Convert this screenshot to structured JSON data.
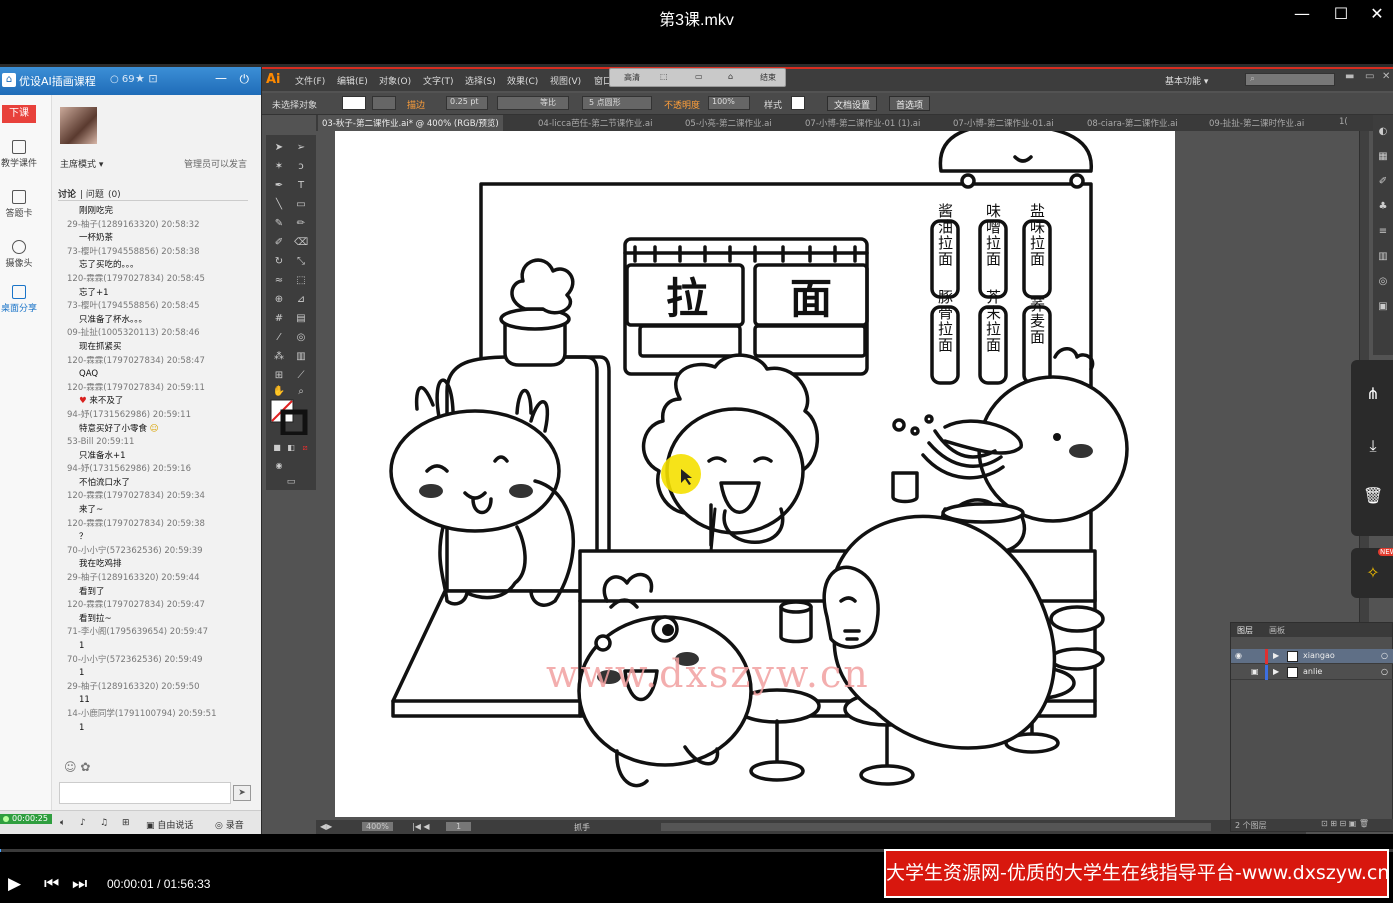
{
  "player": {
    "title": "第3课.mkv",
    "time_current": "00:00:01",
    "time_separator": "/",
    "time_total": "01:56:33",
    "progress_fraction": 0.0001,
    "win_minimize": "—",
    "win_maximize": "☐",
    "win_close": "✕"
  },
  "banner": {
    "text": "大学生资源网-优质的大学生在线指导平台-www.dxszyw.cn"
  },
  "classroom": {
    "title": "优设AI插画课程",
    "count": "69",
    "exit_label": "下课",
    "nav": [
      {
        "label": "教学课件",
        "icon": "courseware-icon"
      },
      {
        "label": "答题卡",
        "icon": "answer-card-icon"
      },
      {
        "label": "摄像头",
        "icon": "camera-icon"
      },
      {
        "label": "桌面分享",
        "icon": "screen-share-icon"
      }
    ],
    "mode": "主席模式",
    "mode_note": "管理员可以发言",
    "tab_discuss": "讨论",
    "tab_question": "问题",
    "tab_question_count": "(0)",
    "messages": [
      {
        "meta": "",
        "text": "刚刚吃完"
      },
      {
        "meta": "29-柚子(1289163320) 20:58:32",
        "text": "一杯奶茶"
      },
      {
        "meta": "73-樱叶(1794558856) 20:58:38",
        "text": "忘了买吃的。。。"
      },
      {
        "meta": "120-霖霖(1797027834) 20:58:45",
        "text": "忘了+1"
      },
      {
        "meta": "73-樱叶(1794558856) 20:58:45",
        "text": "只准备了杯水。。。"
      },
      {
        "meta": "09-扯扯(1005320113) 20:58:46",
        "text": "现在抓紧买"
      },
      {
        "meta": "120-霖霖(1797027834) 20:58:47",
        "text": "QAQ"
      },
      {
        "meta": "120-霖霖(1797027834) 20:59:11",
        "text": "来不及了"
      },
      {
        "meta": "94-妤(1731562986) 20:59:11",
        "text": "特意买好了小零食"
      },
      {
        "meta": "53-Bill 20:59:11",
        "text": "只准备水+1"
      },
      {
        "meta": "94-妤(1731562986) 20:59:16",
        "text": "不怕流口水了"
      },
      {
        "meta": "120-霖霖(1797027834) 20:59:34",
        "text": "来了~"
      },
      {
        "meta": "120-霖霖(1797027834) 20:59:38",
        "text": "？"
      },
      {
        "meta": "70-小小宁(572362536) 20:59:39",
        "text": "我在吃鸡排"
      },
      {
        "meta": "29-柚子(1289163320) 20:59:44",
        "text": "看到了"
      },
      {
        "meta": "120-霖霖(1797027834) 20:59:47",
        "text": "看到拉~"
      },
      {
        "meta": "71-李小阁(1795639654) 20:59:47",
        "text": "1"
      },
      {
        "meta": "70-小小宁(572362536) 20:59:49",
        "text": "1"
      },
      {
        "meta": "29-柚子(1289163320) 20:59:50",
        "text": "11"
      },
      {
        "meta": "14-小鹿同学(1791100794) 20:59:51",
        "text": "1"
      }
    ],
    "live_time": "00:00:25",
    "bottom_free": "自由说话",
    "bottom_record": "录音"
  },
  "illustrator": {
    "logo": "Ai",
    "menus": [
      "文件(F)",
      "编辑(E)",
      "对象(O)",
      "文字(T)",
      "选择(S)",
      "效果(C)",
      "视图(V)",
      "窗口"
    ],
    "quick_bar": {
      "a": "高清",
      "end": "结束"
    },
    "workspace": "基本功能",
    "control": {
      "no_selection": "未选择对象",
      "stroke_label": "描边",
      "stroke_value": "0.25 pt",
      "profile": "等比",
      "brush": "5 点圆形",
      "opacity_label": "不透明度",
      "opacity_value": "100%",
      "style_label": "样式",
      "doc_setup": "文档设置",
      "prefs": "首选项"
    },
    "doc_tabs": [
      "03-秋子-第二课作业.ai* @ 400% (RGB/预览)",
      "04-licca芭任-第二节课作业.ai",
      "05-小亮-第二课作业.ai",
      "07-小博-第二课作业-01 (1).ai",
      "07-小博-第二课作业-01.ai",
      "08-ciara-第二课作业.ai",
      "09-扯扯-第二课时作业.ai",
      "1("
    ],
    "status": {
      "zoom": "400%",
      "page": "1",
      "tool": "抓手"
    },
    "layers": {
      "tab_layers": "图层",
      "tab_artboards": "画板",
      "rows": [
        "xiangao",
        "anlie"
      ],
      "footer": "2 个图层"
    }
  },
  "artwork": {
    "sign_ramen": [
      "拉",
      "面"
    ],
    "menu_items": [
      "酱油拉面",
      "味噌拉面",
      "盐味拉面",
      "豚骨拉面",
      "芥末拉面",
      "荞麦面"
    ],
    "watermark": "www.dxszyw.cn"
  }
}
